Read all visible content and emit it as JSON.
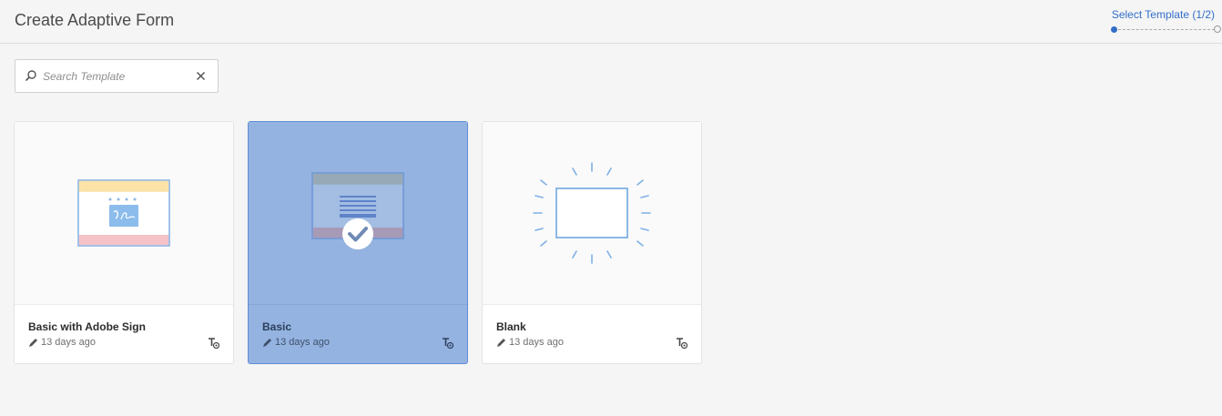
{
  "header": {
    "title": "Create Adaptive Form",
    "wizard": {
      "step_label": "Select Template (1/2)"
    }
  },
  "search": {
    "placeholder": "Search Template",
    "value": ""
  },
  "icons": {
    "search": "search-icon",
    "clear": "close-icon",
    "edit": "pencil-icon",
    "template_badge": "template-badge-icon",
    "selected": "checkmark-icon"
  },
  "colors": {
    "accent": "#326ec8",
    "selected_card": "#94b3e0",
    "selected_border": "#5d8ed8"
  },
  "templates": [
    {
      "title": "Basic with Adobe Sign",
      "modified": "13 days ago",
      "selected": false
    },
    {
      "title": "Basic",
      "modified": "13 days ago",
      "selected": true
    },
    {
      "title": "Blank",
      "modified": "13 days ago",
      "selected": false
    }
  ]
}
